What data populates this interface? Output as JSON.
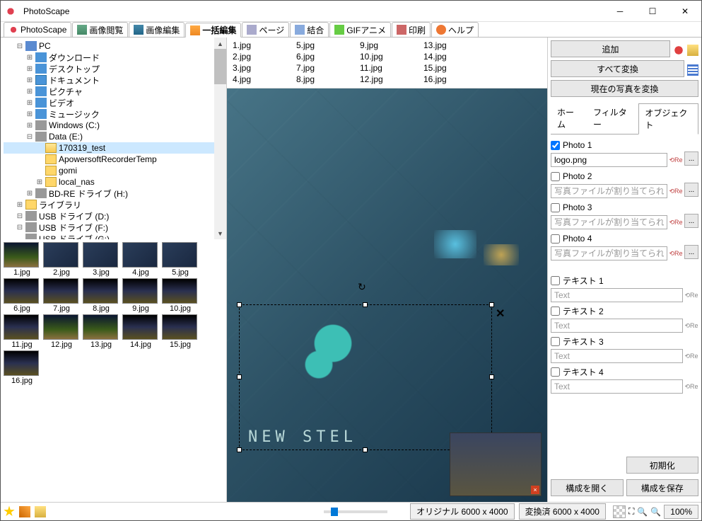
{
  "window": {
    "title": "PhotoScape"
  },
  "main_tabs": [
    {
      "label": "PhotoScape"
    },
    {
      "label": "画像閲覧"
    },
    {
      "label": "画像編集"
    },
    {
      "label": "一括編集"
    },
    {
      "label": "ページ"
    },
    {
      "label": "結合"
    },
    {
      "label": "GIFアニメ"
    },
    {
      "label": "印刷"
    },
    {
      "label": "ヘルプ"
    }
  ],
  "tree": [
    {
      "level": 1,
      "exp": "-",
      "icon": "ic-pc",
      "label": "PC"
    },
    {
      "level": 2,
      "exp": "+",
      "icon": "ic-dl",
      "label": "ダウンロード"
    },
    {
      "level": 2,
      "exp": "+",
      "icon": "ic-desk",
      "label": "デスクトップ"
    },
    {
      "level": 2,
      "exp": "+",
      "icon": "ic-doc",
      "label": "ドキュメント"
    },
    {
      "level": 2,
      "exp": "+",
      "icon": "ic-pic",
      "label": "ピクチャ"
    },
    {
      "level": 2,
      "exp": "+",
      "icon": "ic-vid",
      "label": "ビデオ"
    },
    {
      "level": 2,
      "exp": "+",
      "icon": "ic-mus",
      "label": "ミュージック"
    },
    {
      "level": 2,
      "exp": "+",
      "icon": "ic-drive",
      "label": "Windows (C:)"
    },
    {
      "level": 2,
      "exp": "-",
      "icon": "ic-drive",
      "label": "Data (E:)"
    },
    {
      "level": 3,
      "exp": "",
      "icon": "fld-open",
      "label": "170319_test",
      "selected": true
    },
    {
      "level": 3,
      "exp": "",
      "icon": "fld",
      "label": "ApowersoftRecorderTemp"
    },
    {
      "level": 3,
      "exp": "",
      "icon": "fld",
      "label": "gomi"
    },
    {
      "level": 3,
      "exp": "+",
      "icon": "fld",
      "label": "local_nas"
    },
    {
      "level": 2,
      "exp": "+",
      "icon": "ic-drive",
      "label": "BD-RE ドライブ (H:)"
    },
    {
      "level": 1,
      "exp": "+",
      "icon": "fld",
      "label": "ライブラリ"
    },
    {
      "level": 1,
      "exp": "-",
      "icon": "ic-drive",
      "label": "USB ドライブ (D:)"
    },
    {
      "level": 1,
      "exp": "-",
      "icon": "ic-drive",
      "label": "USB ドライブ (F:)"
    },
    {
      "level": 1,
      "exp": "",
      "icon": "ic-drive",
      "label": "USB ドライブ (G:)"
    }
  ],
  "thumbs": [
    [
      "1.jpg",
      "2.jpg",
      "3.jpg",
      "4.jpg",
      "5.jpg"
    ],
    [
      "6.jpg",
      "7.jpg",
      "8.jpg",
      "9.jpg",
      "10.jpg"
    ],
    [
      "11.jpg",
      "12.jpg",
      "13.jpg",
      "14.jpg",
      "15.jpg"
    ],
    [
      "16.jpg"
    ]
  ],
  "filelist": [
    [
      "1.jpg",
      "2.jpg",
      "3.jpg",
      "4.jpg"
    ],
    [
      "5.jpg",
      "6.jpg",
      "7.jpg",
      "8.jpg"
    ],
    [
      "9.jpg",
      "10.jpg",
      "11.jpg",
      "12.jpg"
    ],
    [
      "13.jpg",
      "14.jpg",
      "15.jpg",
      "16.jpg"
    ]
  ],
  "watermark_text": "NEW STEL",
  "right": {
    "add": "追加",
    "convert_all": "すべて変換",
    "convert_current": "現在の写真を変換",
    "subtabs": {
      "home": "ホーム",
      "filter": "フィルター",
      "object": "オブジェクト"
    },
    "photos": [
      {
        "label": "Photo 1",
        "checked": true,
        "value": "logo.png",
        "has_browse": true
      },
      {
        "label": "Photo 2",
        "checked": false,
        "placeholder": "写真ファイルが割り当てられていま",
        "has_browse": true
      },
      {
        "label": "Photo 3",
        "checked": false,
        "placeholder": "写真ファイルが割り当てられていま",
        "has_browse": true
      },
      {
        "label": "Photo 4",
        "checked": false,
        "placeholder": "写真ファイルが割り当てられていま",
        "has_browse": true
      }
    ],
    "texts": [
      {
        "label": "テキスト 1",
        "placeholder": "Text"
      },
      {
        "label": "テキスト 2",
        "placeholder": "Text"
      },
      {
        "label": "テキスト 3",
        "placeholder": "Text"
      },
      {
        "label": "テキスト 4",
        "placeholder": "Text"
      }
    ],
    "reset": "初期化",
    "open_config": "構成を開く",
    "save_config": "構成を保存"
  },
  "status": {
    "original": "オリジナル 6000 x 4000",
    "converted": "変換済 6000 x 4000",
    "zoom": "100%"
  }
}
